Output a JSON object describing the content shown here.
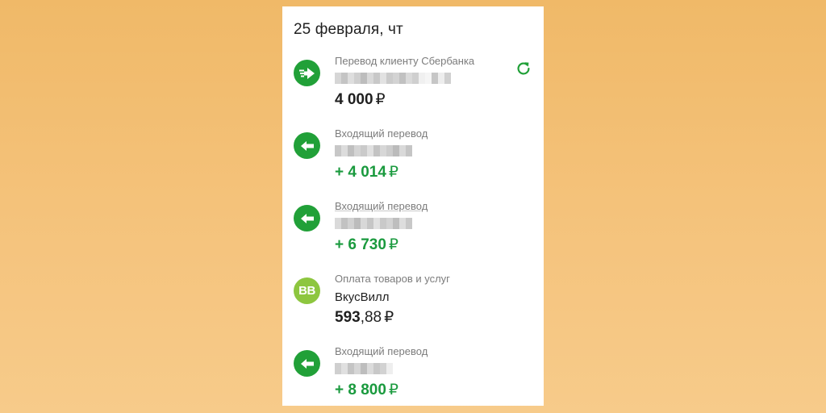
{
  "header": {
    "date": "25 февраля, чт"
  },
  "transactions": [
    {
      "category": "Перевод клиенту Сбербанка",
      "amount": "4 000",
      "currency": "₽",
      "icon": "arrow-right-fast-icon"
    },
    {
      "category": "Входящий перевод",
      "amount": "+ 4 014",
      "currency": "₽",
      "icon": "arrow-left-icon"
    },
    {
      "category": "Входящий перевод",
      "amount": "+ 6 730",
      "currency": "₽",
      "icon": "arrow-left-icon"
    },
    {
      "category": "Оплата товаров и услуг",
      "party": "ВкусВилл",
      "amount_int": "593",
      "amount_frac": ",88",
      "currency": "₽",
      "icon_text": "BB",
      "icon": "vkusvill-logo-icon"
    },
    {
      "category": "Входящий перевод",
      "amount": "+ 8 800",
      "currency": "₽",
      "icon": "arrow-left-icon"
    }
  ],
  "colors": {
    "sber_green": "#21a038",
    "income_green": "#1a9a3e",
    "vkusvill_green": "#8dc63f",
    "background_orange": "#f3bf76"
  }
}
